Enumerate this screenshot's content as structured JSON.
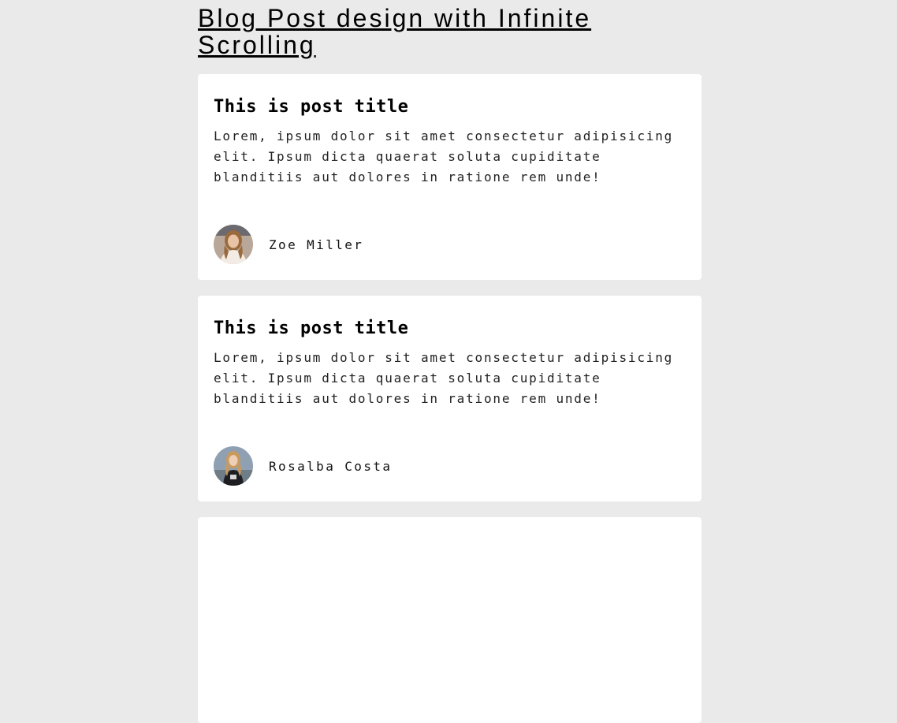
{
  "page": {
    "title": "Blog Post design with Infinite Scrolling"
  },
  "posts": [
    {
      "title": "This is post title",
      "body": "Lorem, ipsum dolor sit amet consectetur adipisicing elit. Ipsum dicta quaerat soluta cupiditate blanditiis aut dolores in ratione rem unde!",
      "author": "Zoe Miller",
      "avatar_icon": "woman-portrait-avatar"
    },
    {
      "title": "This is post title",
      "body": "Lorem, ipsum dolor sit amet consectetur adipisicing elit. Ipsum dicta quaerat soluta cupiditate blanditiis aut dolores in ratione rem unde!",
      "author": "Rosalba Costa",
      "avatar_icon": "woman-portrait-avatar"
    }
  ],
  "colors": {
    "background": "#eaeaea",
    "card": "#ffffff",
    "text": "#000000"
  }
}
